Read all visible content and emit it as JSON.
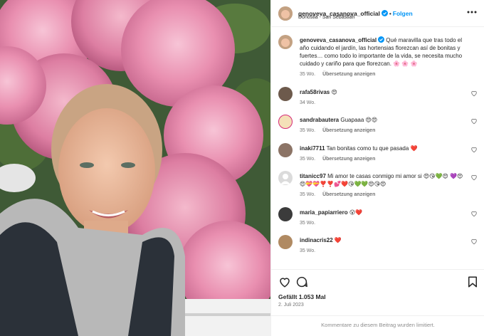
{
  "post": {
    "username": "genoveva_casanova_official",
    "location": "Donostia - San Sebastián",
    "follow_label": "Folgen",
    "dot": "•",
    "caption": "Qué maravilla que tras todo el año cuidando el jardín, las hortensias florezcan así de bonitas y fuertes… como todo lo importante de la vida, se necesita mucho cuidado y cariño para que florezcan. 🌸 🌸 🌸",
    "caption_time": "35 Wo.",
    "translate_label": "Übersetzung anzeigen"
  },
  "comments": [
    {
      "user": "rafa58rivas",
      "text": "😍",
      "time": "34 Wo.",
      "reply": ""
    },
    {
      "user": "sandrabautera",
      "text": "Guapaaa 😍😍",
      "time": "35 Wo.",
      "reply": "Übersetzung anzeigen"
    },
    {
      "user": "inaki7711",
      "text": "Tan bonitas como tu que pasada ❤️",
      "time": "35 Wo.",
      "reply": "Übersetzung anzeigen"
    },
    {
      "user": "titanicc97",
      "text": "Mi amor te casas conmigo mi amor si 😍😘💚😍 💜😍😍💝💝❣️❣️💕❤️😘💚💚😍😘😍",
      "time": "35 Wo.",
      "reply": "Übersetzung anzeigen"
    },
    {
      "user": "maria_papiarriero",
      "text": "😮❤️",
      "time": "35 Wo.",
      "reply": ""
    },
    {
      "user": "indinacris22",
      "text": "❤️",
      "time": "35 Wo.",
      "reply": ""
    }
  ],
  "footer": {
    "likes": "Gefällt 1.053 Mal",
    "date": "2. Juli 2023",
    "limited": "Kommentare zu diesem Beitrag wurden limitiert."
  },
  "colors": {
    "accent": "#0095f6",
    "heart_red": "#ed4956",
    "hydrangea": "#e98fb0"
  },
  "icons": [
    "verified-icon",
    "more-options-icon",
    "heart-icon",
    "comment-icon",
    "bookmark-icon"
  ]
}
